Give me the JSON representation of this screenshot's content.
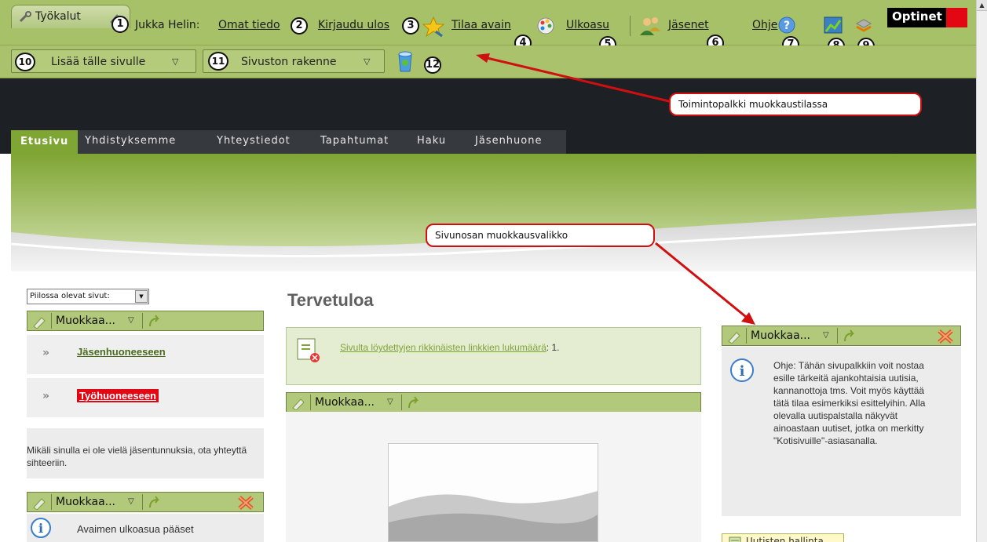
{
  "toolbar": {
    "tools_tab": "Työkalut",
    "user_label": "Jukka Helin:",
    "own_info": "Omat tiedo",
    "logout": "Kirjaudu ulos",
    "order_key": "Tilaa avain",
    "appearance": "Ulkoasu",
    "members": "Jäsenet",
    "help": "Ohje",
    "brand": "Optinet",
    "add_to_page": "Lisää tälle sivulle",
    "site_structure": "Sivuston rakenne"
  },
  "badges": [
    "1",
    "2",
    "3",
    "4",
    "5",
    "6",
    "7",
    "8",
    "9",
    "10",
    "11",
    "12"
  ],
  "callouts": {
    "toolbar_mode": "Toimintopalkki muokkaustilassa",
    "section_menu": "Sivunosan muokkausvalikko"
  },
  "nav": {
    "items": [
      "Etusivu",
      "Yhdistyksemme",
      "Yhteystiedot",
      "Tapahtumat",
      "Haku",
      "Jäsenhuone"
    ]
  },
  "left": {
    "hidden_pages_select": "Piilossa olevat sivut:",
    "edit_label": "Muokkaa...",
    "link1": "Jäsenhuoneeseen",
    "link2": "Työhuoneeseen",
    "info": "Mikäli sinulla ei ole vielä jäsentunnuksia, ota yhteyttä sihteeriin.",
    "edit_label2": "Muokkaa...",
    "bottom_info": "Avaimen ulkoasua pääset"
  },
  "main": {
    "title": "Tervetuloa",
    "broken_link_text": "Sivulta löydettyjen rikkinäisten linkkien lukumäärä",
    "broken_link_count": ": 1.",
    "edit_label": "Muokkaa..."
  },
  "right": {
    "edit_label": "Muokkaa...",
    "help_text": "Ohje: Tähän sivupalkkiin voit nostaa esille tärkeitä ajankohtaisia uutisia, kannanottoja tms. Voit myös käyttää tätä tilaa esimerkiksi esittelyihin. Alla olevalla uutispalstalla näkyvät ainoastaan uutiset, jotka on merkitty \"Kotisivuille\"-asiasanalla.",
    "news_button": "Uutisten hallinta"
  },
  "colors": {
    "toolbar_green": "#a7c169",
    "nav_active": "#7fa534",
    "dark_header": "#1d2024",
    "callout_red": "#d01010",
    "brand_red": "#e30613"
  }
}
